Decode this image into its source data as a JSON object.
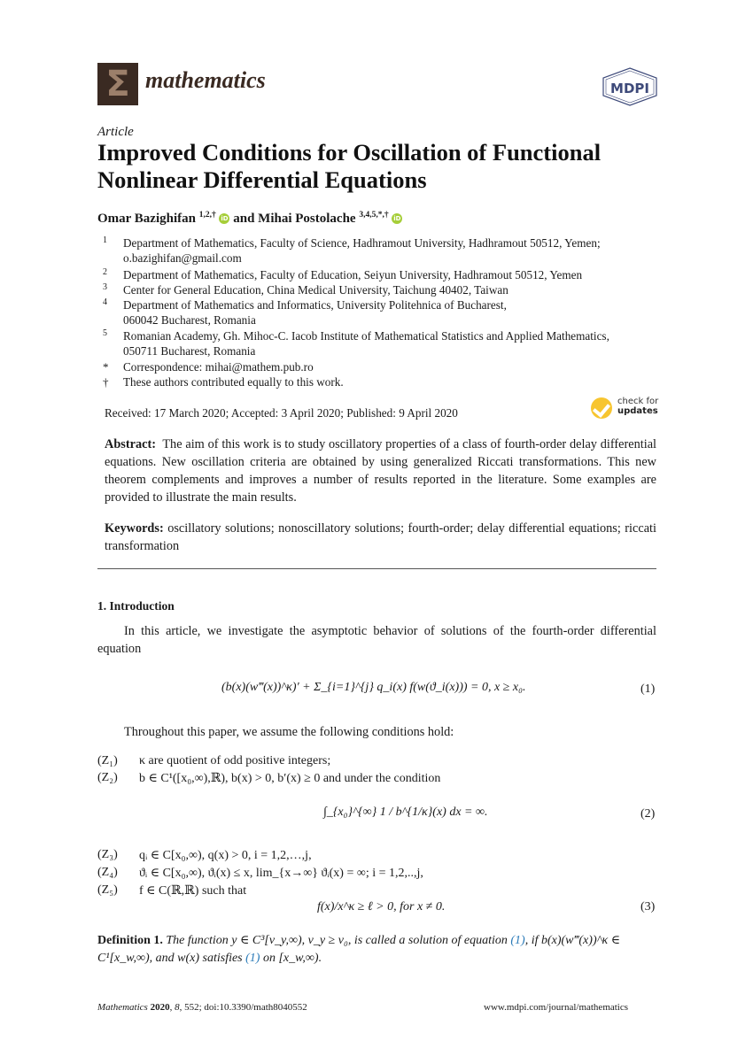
{
  "header": {
    "journal_name": "mathematics",
    "logo_glyph": "Σ",
    "publisher_logo_text": "MDPI",
    "colors": {
      "logo_bg": "#3a2a22",
      "logo_glyph": "#9c7f6a",
      "orcid": "#a6ce39",
      "check_badge": "#f7c530",
      "link": "#2a7ab8"
    }
  },
  "article": {
    "type": "Article",
    "title": "Improved Conditions for Oscillation of Functional Nonlinear Differential Equations",
    "authors": [
      {
        "name": "Omar Bazighifan",
        "marks": "1,2,†",
        "orcid_icon": "iD"
      },
      {
        "name": "Mihai Postolache",
        "marks": "3,4,5,*,†",
        "orcid_icon": "iD"
      }
    ],
    "author_conjunction": "and",
    "affiliations": [
      {
        "mark": "1",
        "text": "Department of Mathematics, Faculty of Science, Hadhramout University, Hadhramout 50512, Yemen;",
        "text2": "o.bazighifan@gmail.com"
      },
      {
        "mark": "2",
        "text": "Department of Mathematics, Faculty of Education, Seiyun University, Hadhramout 50512, Yemen"
      },
      {
        "mark": "3",
        "text": "Center for General Education, China Medical University, Taichung 40402, Taiwan"
      },
      {
        "mark": "4",
        "text": "Department of Mathematics and Informatics, University Politehnica of Bucharest,",
        "text2": "060042 Bucharest, Romania"
      },
      {
        "mark": "5",
        "text": "Romanian Academy, Gh. Mihoc-C. Iacob Institute of Mathematical Statistics and Applied Mathematics,",
        "text2": "050711 Bucharest, Romania"
      },
      {
        "mark": "*",
        "text": "Correspondence: mihai@mathem.pub.ro"
      },
      {
        "mark": "†",
        "text": "These authors contributed equally to this work."
      }
    ],
    "dates": "Received: 17 March 2020; Accepted: 3 April 2020; Published: 9 April 2020",
    "check_updates": {
      "line1": "check for",
      "line2": "updates"
    },
    "abstract_label": "Abstract:",
    "abstract": "The aim of this work is to study oscillatory properties of a class of fourth-order delay differential equations. New oscillation criteria are obtained by using generalized Riccati transformations. This new theorem complements and improves a number of results reported in the literature. Some examples are provided to illustrate the main results.",
    "keywords_label": "Keywords:",
    "keywords": "oscillatory solutions; nonoscillatory solutions; fourth-order; delay differential equations; riccati transformation"
  },
  "body": {
    "section_title": "1. Introduction",
    "intro_paragraph": "In this article, we investigate the asymptotic behavior of solutions of the fourth-order differential equation",
    "equation1": "(b(x)(w‴(x))^κ)′ + Σ_{i=1}^{j} q_i(x) f(w(ϑ_i(x))) = 0, x ≥ x₀.",
    "equation1_number": "(1)",
    "assume_text": "Throughout this paper, we assume the following conditions hold:",
    "conditions": [
      {
        "label": "(Z₁)",
        "text": "κ are quotient of odd positive integers;"
      },
      {
        "label": "(Z₂)",
        "text": "b ∈ C¹([x₀,∞),ℝ), b(x) > 0, b′(x) ≥ 0 and under the condition"
      },
      {
        "label": "(Z₃)",
        "text": "qᵢ ∈ C[x₀,∞), q(x) > 0, i = 1,2,…,j,"
      },
      {
        "label": "(Z₄)",
        "text": "ϑᵢ ∈ C[x₀,∞), ϑᵢ(x) ≤ x, lim_{x→∞} ϑᵢ(x) = ∞; i = 1,2,..,j,"
      },
      {
        "label": "(Z₅)",
        "text": "f ∈ C(ℝ,ℝ) such that"
      }
    ],
    "equation2": "∫_{x₀}^{∞} 1 / b^{1/κ}(x) dx = ∞.",
    "equation2_number": "(2)",
    "equation3": "f(x)/x^κ ≥ ℓ > 0, for x ≠ 0.",
    "equation3_number": "(3)",
    "definition_label": "Definition 1.",
    "definition_text_a": "The function y ∈ C³[ν_y,∞), ν_y ≥ ν₀, is called a solution of equation",
    "definition_ref1": "(1)",
    "definition_text_b": ", if b(x)(w‴(x))^κ ∈",
    "definition_text_c": "C¹[x_w,∞), and w(x) satisfies",
    "definition_ref2": "(1)",
    "definition_text_d": "on [x_w,∞)."
  },
  "footer": {
    "citation_journal": "Mathematics",
    "citation_year": "2020",
    "citation_volume": "8",
    "citation_rest": ", 552; doi:10.3390/math8040552",
    "url": "www.mdpi.com/journal/mathematics"
  }
}
